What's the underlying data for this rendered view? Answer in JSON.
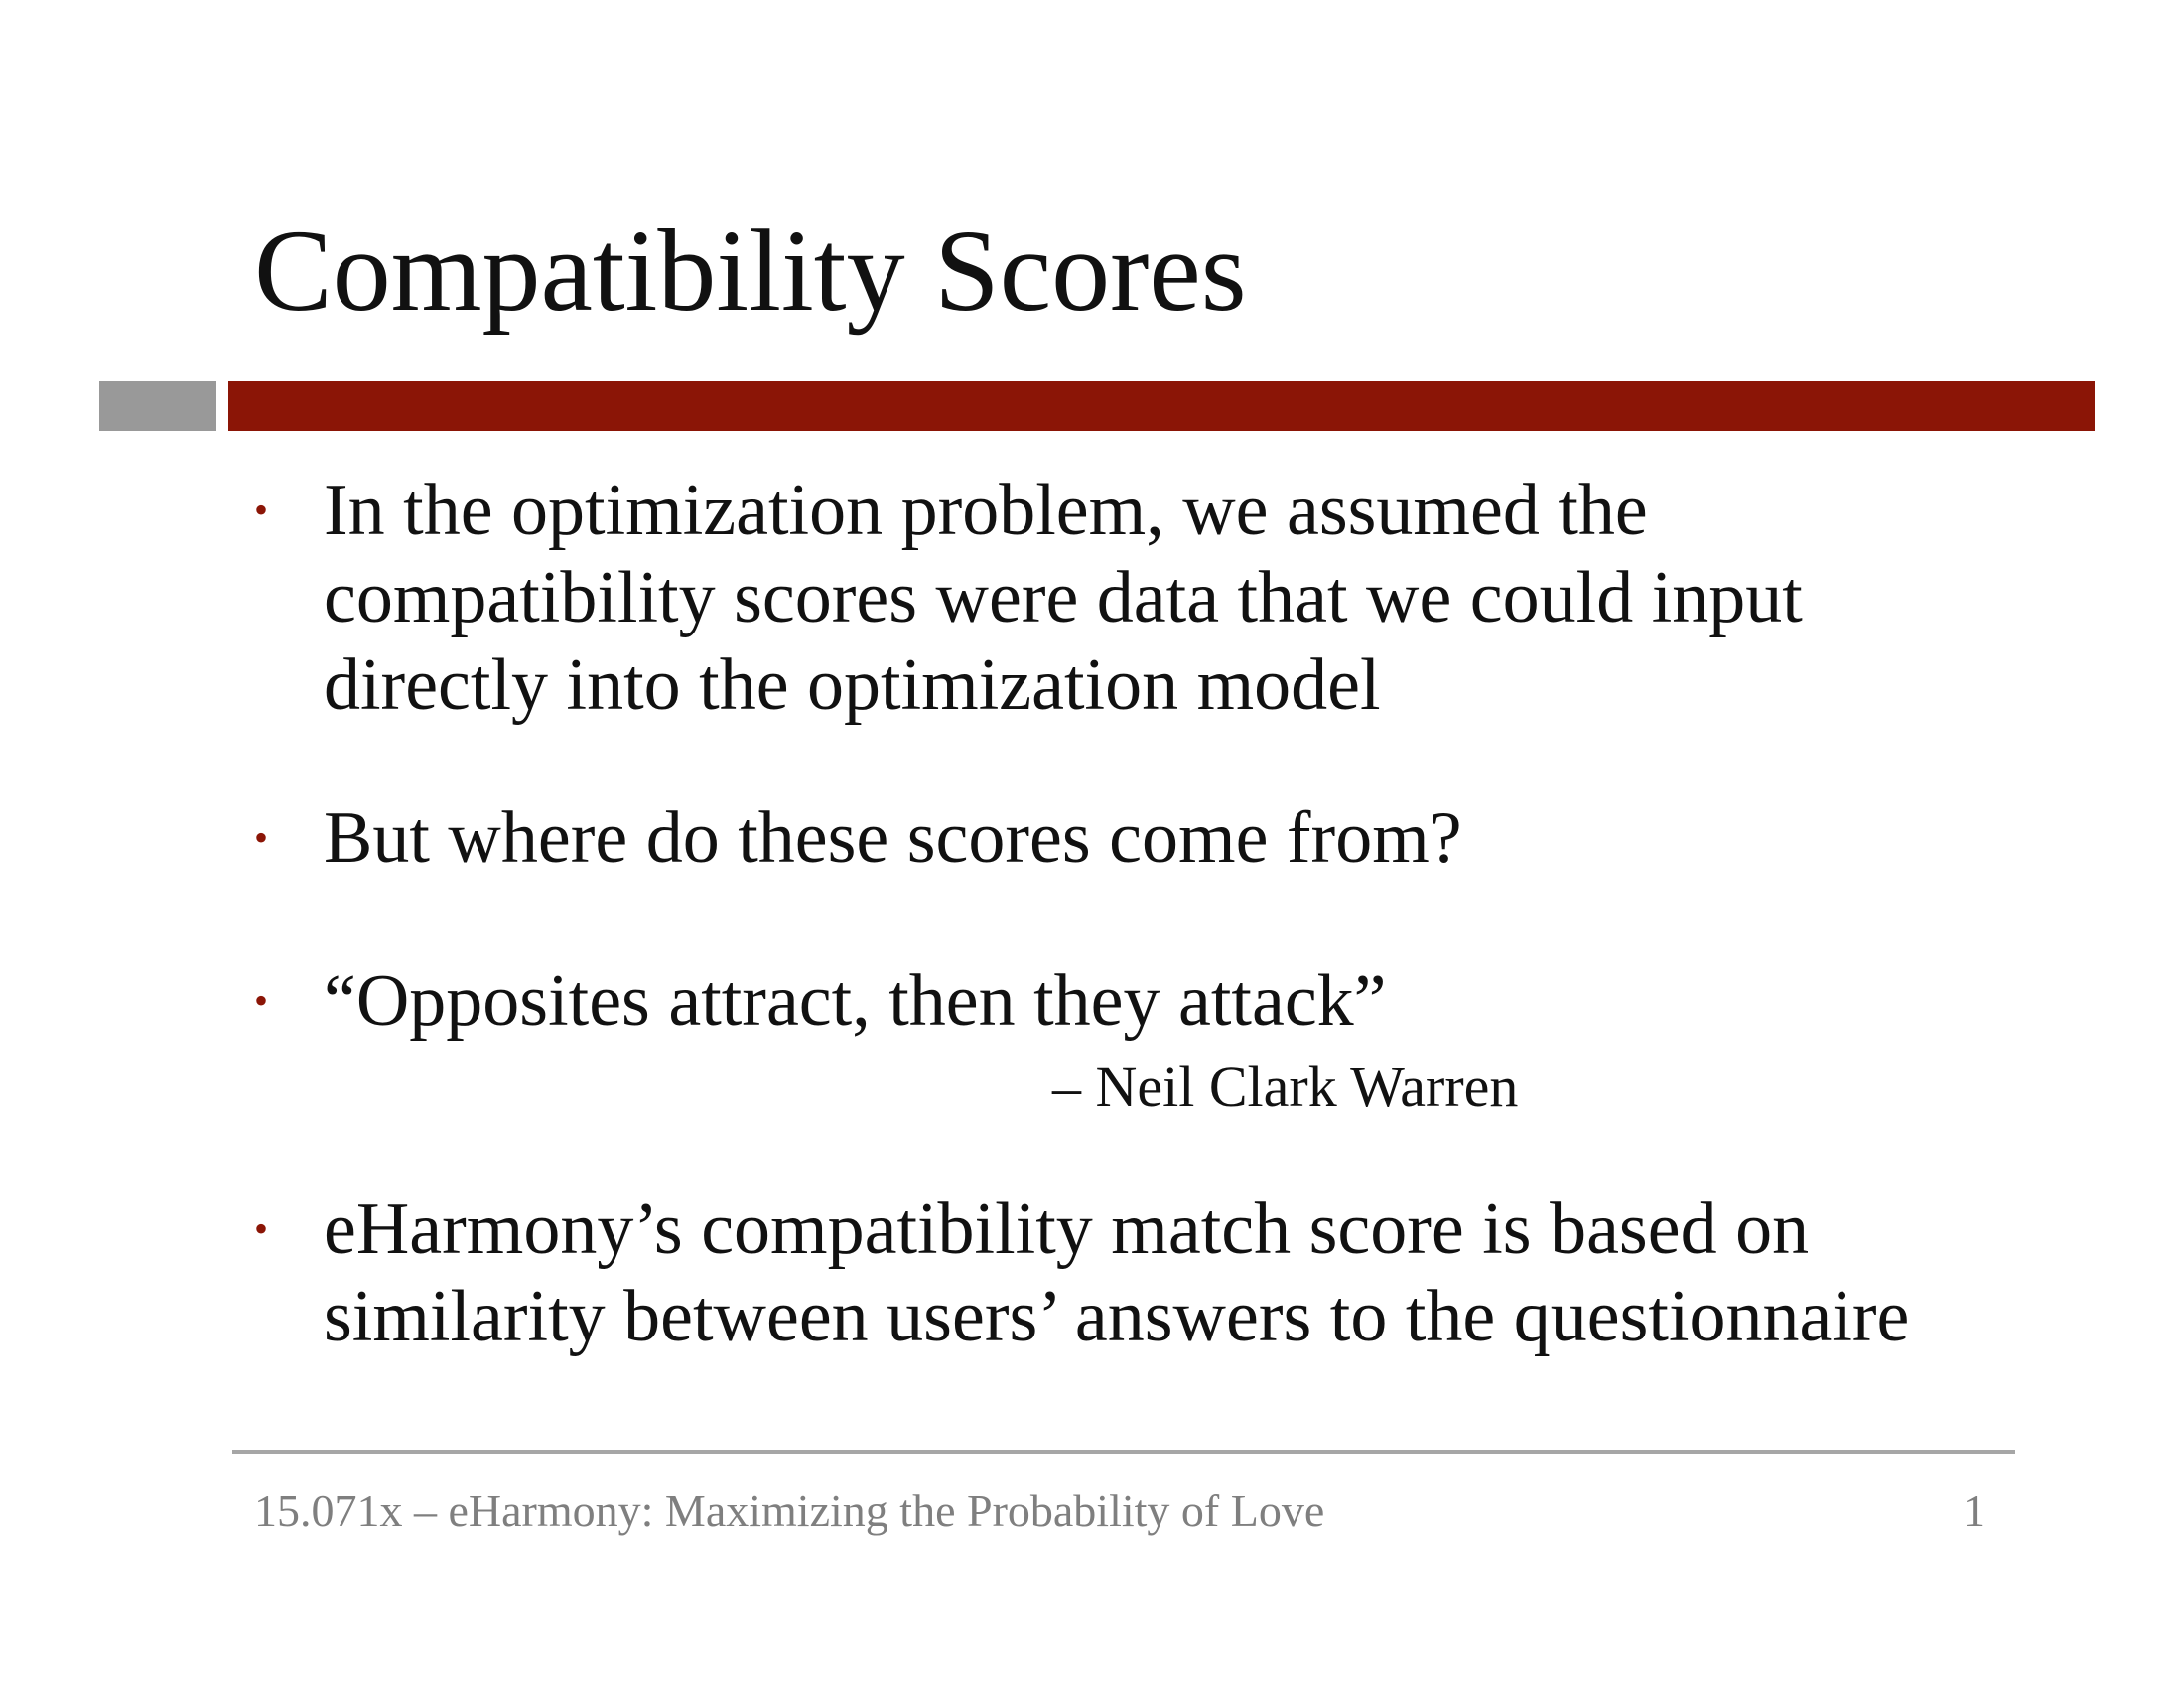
{
  "slide": {
    "title": "Compatibility Scores",
    "bullets": [
      {
        "lines": [
          "In the optimization problem, we assumed the",
          "compatibility scores were data that we could input",
          "directly into the optimization model"
        ]
      },
      {
        "lines": [
          "But where do these scores come from?"
        ]
      },
      {
        "lines": [
          "“Opposites attract, then they attack”"
        ],
        "attribution": "– Neil Clark Warren"
      },
      {
        "lines": [
          "eHarmony’s compatibility match score is based on",
          "similarity between users’ answers to the questionnaire"
        ]
      }
    ],
    "bullet_symbol": "•"
  },
  "footer": {
    "text": "15.071x – eHarmony: Maximizing the Probability of Love",
    "page_number": "1"
  },
  "colors": {
    "accent_red": "#8b1506",
    "accent_gray": "#999999",
    "footer_text": "#7f7f7f"
  }
}
